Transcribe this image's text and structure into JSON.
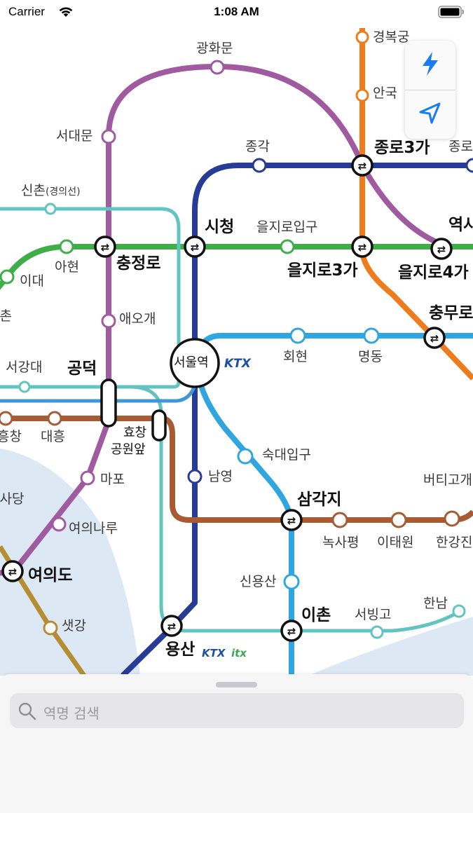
{
  "status_bar": {
    "carrier": "Carrier",
    "time": "1:08 AM"
  },
  "colors": {
    "line_green": "#3fae49",
    "line_orange": "#ef7c1c",
    "line_navy": "#263c96",
    "line_sky": "#30a6e0",
    "line_purple": "#a05aa0",
    "line_teal": "#62c4c1",
    "line_brown": "#a85a33",
    "line_gold": "#b58e32",
    "river": "#dbe7f5",
    "ktx": "#1f4fa3",
    "itx": "#3aa858"
  },
  "map": {
    "stations": {
      "gyeongbokgung": "경복궁",
      "gwanghwamun": "광화문",
      "anguk": "안국",
      "seodaemun": "서대문",
      "jonggak": "종각",
      "jongno3ga": "종로3가",
      "jongno5ga_partial": "종로",
      "sinchon": "신촌",
      "sinchon_sub": "(경의선)",
      "cityhall": "시청",
      "euljiro1ga": "을지로입구",
      "dongdaemun_partial": "역사",
      "ahyeon": "아현",
      "chungjeongno": "충정로",
      "euljiro3ga": "을지로3가",
      "euljiro4ga": "을지로4가",
      "idae": "이대",
      "sinchon2_partial": "신촌",
      "aeogae": "애오개",
      "chungmuro": "충무로",
      "seoul_station": "서울역",
      "hoehyeon": "회현",
      "myeongdong": "명동",
      "seogangdae": "서강대",
      "gongdeok": "공덕",
      "sangsu_partial": "흥창",
      "daeheung": "대흥",
      "hyochang_line1": "효창",
      "hyochang_line2": "공원앞",
      "sookmyung": "숙대입구",
      "namyeong": "남영",
      "beotigogae": "버티고개",
      "mapo": "마포",
      "yeouinaru": "여의나루",
      "assembly_partial": "의사당",
      "samgakji": "삼각지",
      "noksapyeong": "녹사평",
      "itaewon": "이태원",
      "hangangjin_partial": "한강진",
      "yeouido": "여의도",
      "sinyongsan": "신용산",
      "hannam": "한남",
      "saetgang": "샛강",
      "ichon": "이촌",
      "seobinggo": "서빙고",
      "yongsan": "용산"
    },
    "badges": {
      "ktx": "KTX",
      "itx": "itx"
    }
  },
  "controls": {
    "lightning_icon": "lightning-icon",
    "location_icon": "location-arrow-icon"
  },
  "search": {
    "placeholder": "역명 검색",
    "icon": "search-icon"
  }
}
